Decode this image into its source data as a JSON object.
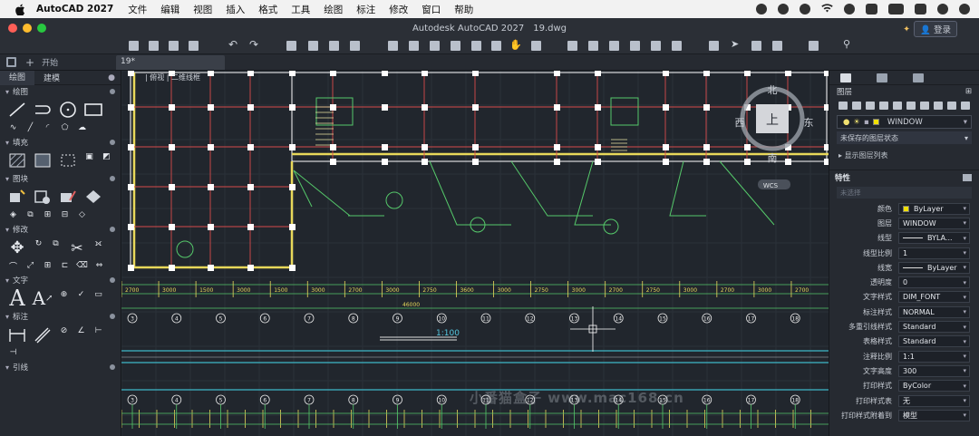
{
  "menubar": {
    "app_name": "AutoCAD 2027",
    "items": [
      "文件",
      "编辑",
      "视图",
      "插入",
      "格式",
      "工具",
      "绘图",
      "标注",
      "修改",
      "窗口",
      "帮助"
    ]
  },
  "window": {
    "title": "Autodesk AutoCAD 2027",
    "doc_title": "19.dwg",
    "login": "登录"
  },
  "tabs": {
    "start": "开始",
    "doc_tab": "19*"
  },
  "left_palette": {
    "tabs": [
      "绘图",
      "建模"
    ],
    "sections": [
      "绘图",
      "填充",
      "图块",
      "修改",
      "文字",
      "标注",
      "引线"
    ]
  },
  "view_label": "| 俯视 | 二维线框",
  "drawing": {
    "scale_label": "1:100",
    "compass": {
      "north": "北",
      "south": "南",
      "west": "西",
      "east": "东",
      "top": "上"
    },
    "wcs": "WCS",
    "dim_row1": [
      "2700",
      "3000",
      "1500",
      "3000",
      "1500",
      "3000",
      "2700",
      "3000",
      "2750",
      "3600",
      "3000",
      "2750",
      "3000",
      "2700",
      "2750",
      "3000",
      "2700",
      "3000",
      "2700"
    ],
    "dim_total": "46000",
    "axis_labels": [
      "3",
      "4",
      "5",
      "6",
      "7",
      "8",
      "9",
      "10",
      "11",
      "12",
      "13",
      "14",
      "15",
      "16",
      "17",
      "18"
    ]
  },
  "watermark": "小番猫盒子 www.mac168.cn",
  "right_palette": {
    "layer_title": "图层",
    "current_layer": "WINDOW",
    "layer_state": "未保存的图层状态",
    "show_list": "显示图层列表",
    "props_title": "特性",
    "no_selection": "未选择",
    "properties": [
      {
        "label": "颜色",
        "value": "ByLayer",
        "kind": "color"
      },
      {
        "label": "图层",
        "value": "WINDOW",
        "kind": "text"
      },
      {
        "label": "线型",
        "value": "BYLA...",
        "kind": "line"
      },
      {
        "label": "线型比例",
        "value": "1",
        "kind": "text"
      },
      {
        "label": "线宽",
        "value": "ByLayer",
        "kind": "line"
      },
      {
        "label": "透明度",
        "value": "0",
        "kind": "text"
      },
      {
        "label": "文字样式",
        "value": "DIM_FONT",
        "kind": "text"
      },
      {
        "label": "标注样式",
        "value": "NORMAL",
        "kind": "text"
      },
      {
        "label": "多重引线样式",
        "value": "Standard",
        "kind": "text"
      },
      {
        "label": "表格样式",
        "value": "Standard",
        "kind": "text"
      },
      {
        "label": "注释比例",
        "value": "1:1",
        "kind": "text"
      },
      {
        "label": "文字高度",
        "value": "300",
        "kind": "text"
      },
      {
        "label": "打印样式",
        "value": "ByColor",
        "kind": "text"
      },
      {
        "label": "打印样式表",
        "value": "无",
        "kind": "text"
      },
      {
        "label": "打印样式附着到",
        "value": "模型",
        "kind": "text"
      }
    ]
  }
}
